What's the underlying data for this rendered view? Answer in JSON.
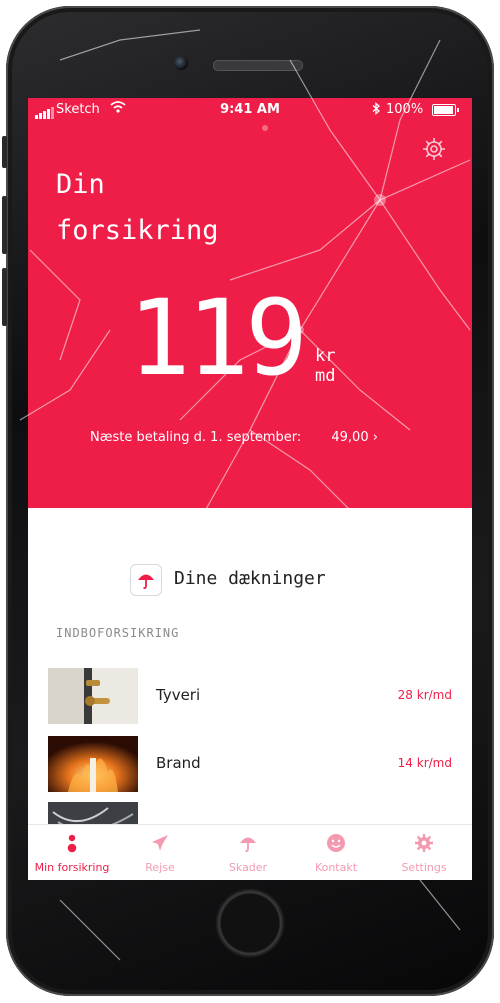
{
  "colors": {
    "accent": "#ee1e48",
    "tab_inactive": "#f39ab1"
  },
  "status_bar": {
    "carrier": "Sketch",
    "time": "9:41 AM",
    "battery": "100%"
  },
  "header": {
    "title_line1": "Din",
    "title_line2": "forsikring",
    "settings_icon": "gear-icon"
  },
  "price": {
    "amount": "119",
    "unit_line1": "kr",
    "unit_line2": "md",
    "next_payment_label": "Næste betaling d. 1. september:",
    "next_payment_amount": "49,00",
    "next_payment_arrow": "›"
  },
  "coverage": {
    "icon": "umbrella-icon",
    "title": "Dine dækninger",
    "section_label": "INDBOFORSIKRING",
    "items": [
      {
        "name": "Tyveri",
        "price": "28 kr/md",
        "image": "door-lock-photo"
      },
      {
        "name": "Brand",
        "price": "14 kr/md",
        "image": "fire-photo"
      },
      {
        "name": "",
        "price": "",
        "image": "cables-photo"
      }
    ]
  },
  "tabs": [
    {
      "label": "Min forsikring",
      "icon": "profile-icon",
      "active": true
    },
    {
      "label": "Rejse",
      "icon": "plane-icon",
      "active": false
    },
    {
      "label": "Skader",
      "icon": "umbrella-icon",
      "active": false
    },
    {
      "label": "Kontakt",
      "icon": "smiley-icon",
      "active": false
    },
    {
      "label": "Settings",
      "icon": "gear-icon",
      "active": false
    }
  ]
}
